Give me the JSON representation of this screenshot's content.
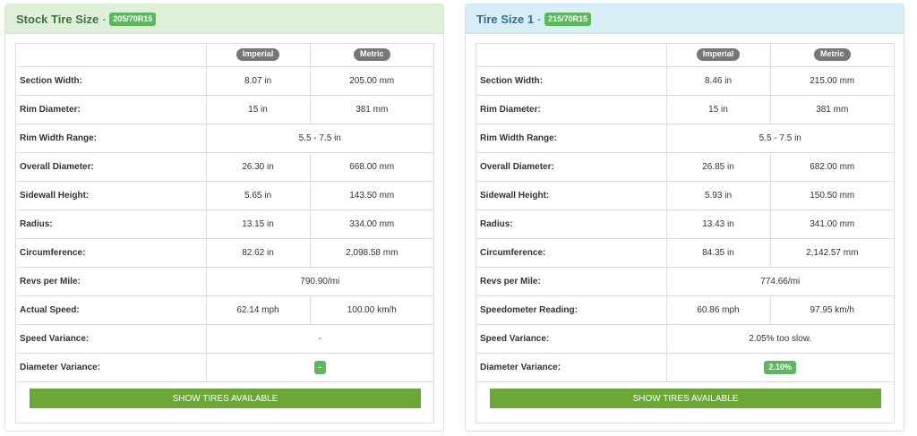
{
  "left": {
    "title": "Stock Tire Size",
    "size_badge": "205/70R15",
    "header_imperial": "Imperial",
    "header_metric": "Metric",
    "rows": [
      {
        "label": "Section Width:",
        "imperial": "8.07 in",
        "metric": "205.00 mm"
      },
      {
        "label": "Rim Diameter:",
        "imperial": "15 in",
        "metric": "381 mm"
      },
      {
        "label": "Rim Width Range:",
        "combined": "5.5 - 7.5 in"
      },
      {
        "label": "Overall Diameter:",
        "imperial": "26.30 in",
        "metric": "668.00 mm"
      },
      {
        "label": "Sidewall Height:",
        "imperial": "5.65 in",
        "metric": "143.50 mm"
      },
      {
        "label": "Radius:",
        "imperial": "13.15 in",
        "metric": "334.00 mm"
      },
      {
        "label": "Circumference:",
        "imperial": "82.62 in",
        "metric": "2,098.58 mm"
      },
      {
        "label": "Revs per Mile:",
        "combined": "790.90/mi"
      },
      {
        "label": "Actual Speed:",
        "imperial": "62.14 mph",
        "metric": "100.00 km/h"
      },
      {
        "label": "Speed Variance:",
        "combined": "-"
      },
      {
        "label": "Diameter Variance:",
        "badge": "-"
      }
    ],
    "button_label": "SHOW TIRES AVAILABLE"
  },
  "right": {
    "title": "Tire Size 1",
    "size_badge": "215/70R15",
    "header_imperial": "Imperial",
    "header_metric": "Metric",
    "rows": [
      {
        "label": "Section Width:",
        "imperial": "8.46 in",
        "metric": "215.00 mm"
      },
      {
        "label": "Rim Diameter:",
        "imperial": "15 in",
        "metric": "381 mm"
      },
      {
        "label": "Rim Width Range:",
        "combined": "5.5 - 7.5 in"
      },
      {
        "label": "Overall Diameter:",
        "imperial": "26.85 in",
        "metric": "682.00 mm"
      },
      {
        "label": "Sidewall Height:",
        "imperial": "5.93 in",
        "metric": "150.50 mm"
      },
      {
        "label": "Radius:",
        "imperial": "13.43 in",
        "metric": "341.00 mm"
      },
      {
        "label": "Circumference:",
        "imperial": "84.35 in",
        "metric": "2,142.57 mm"
      },
      {
        "label": "Revs per Mile:",
        "combined": "774.66/mi"
      },
      {
        "label": "Speedometer Reading:",
        "imperial": "60.86 mph",
        "metric": "97.95 km/h"
      },
      {
        "label": "Speed Variance:",
        "combined": "2.05% too slow."
      },
      {
        "label": "Diameter Variance:",
        "badge": "2.10%"
      }
    ],
    "button_label": "SHOW TIRES AVAILABLE"
  },
  "colors": {
    "left_header_bg": "#dff0d8",
    "right_header_bg": "#d9edf7",
    "badge_green": "#5cb85c",
    "button_green": "#6aa737",
    "pill_grey": "#777777"
  }
}
